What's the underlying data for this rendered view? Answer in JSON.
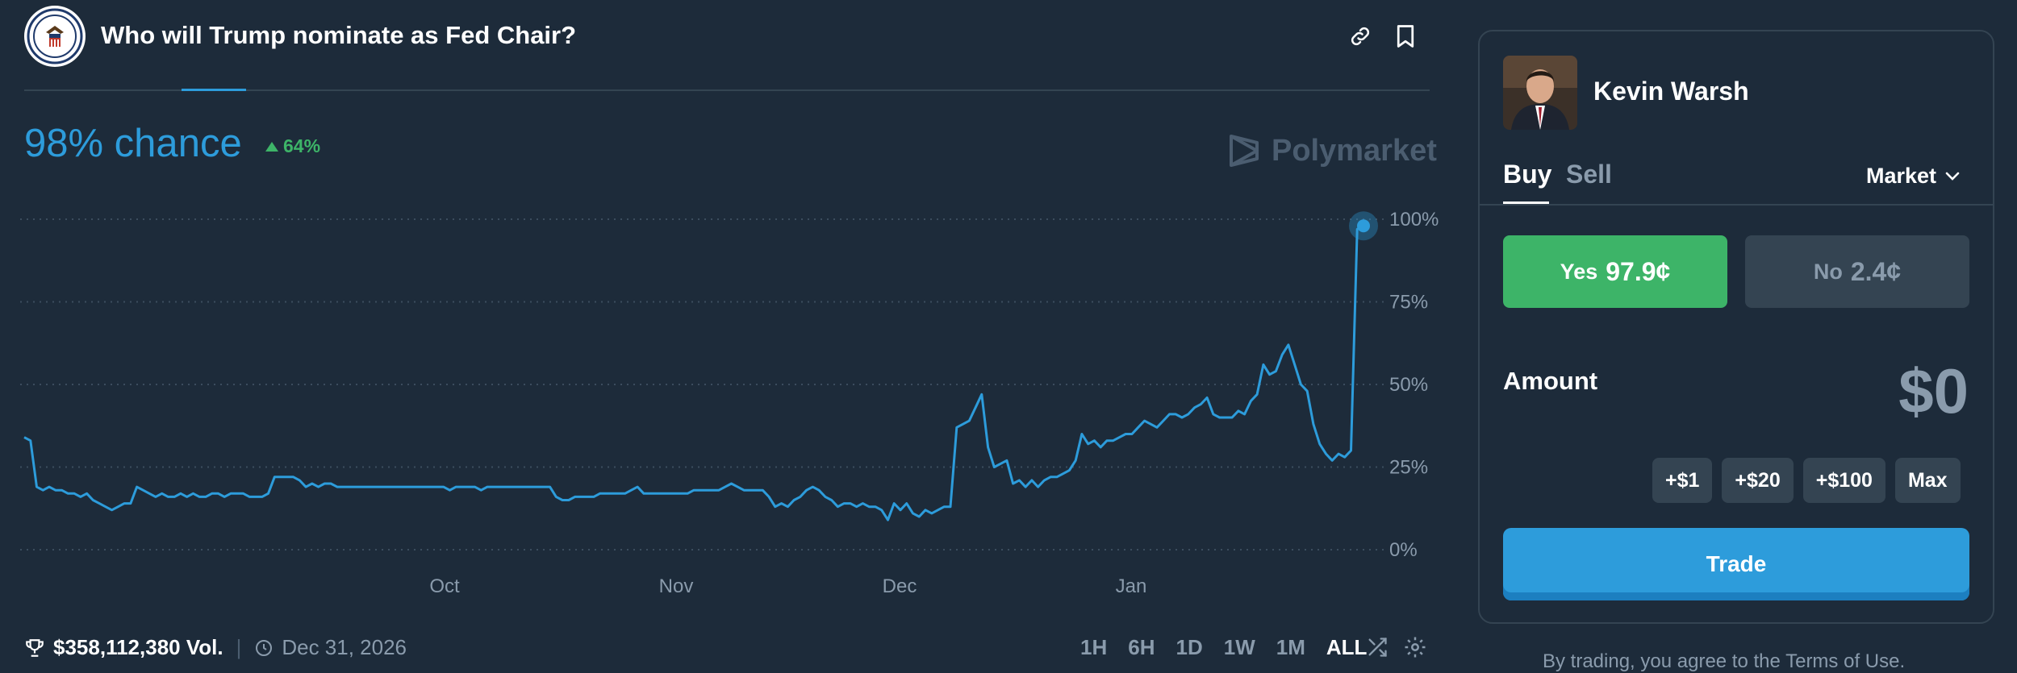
{
  "header": {
    "title": "Who will Trump nominate as Fed Chair?",
    "icons": [
      "link-icon",
      "bookmark-icon"
    ]
  },
  "summary": {
    "chance": "98% chance",
    "delta": "64%"
  },
  "watermark": "Polymarket",
  "chart_data": {
    "type": "line",
    "y_ticks": [
      "100%",
      "75%",
      "50%",
      "25%",
      "0%"
    ],
    "x_ticks": [
      "Oct",
      "Nov",
      "Dec",
      "Jan"
    ],
    "ylim": [
      0,
      100
    ],
    "grid": true,
    "color": "#2d9cdb",
    "series": [
      {
        "values": [
          34,
          33,
          19,
          18,
          19,
          18,
          18,
          17,
          17,
          16,
          17,
          15,
          14,
          13,
          12,
          13,
          14,
          14,
          19,
          18,
          17,
          16,
          17,
          16,
          16,
          17,
          16,
          17,
          16,
          16,
          17,
          17,
          16,
          17,
          17,
          17,
          16,
          16,
          16,
          17,
          22,
          22,
          22,
          22,
          21,
          19,
          20,
          19,
          20,
          20,
          19,
          19,
          19,
          19,
          19,
          19,
          19,
          19,
          19,
          19,
          19,
          19,
          19,
          19,
          19,
          19,
          19,
          19,
          18,
          19,
          19,
          19,
          19,
          18,
          19,
          19,
          19,
          19,
          19,
          19,
          19,
          19,
          19,
          19,
          19,
          16,
          15,
          15,
          16,
          16,
          16,
          16,
          17,
          17,
          17,
          17,
          17,
          18,
          19,
          17,
          17,
          17,
          17,
          17,
          17,
          17,
          17,
          18,
          18,
          18,
          18,
          18,
          19,
          20,
          19,
          18,
          18,
          18,
          18,
          16,
          13,
          14,
          13,
          15,
          16,
          18,
          19,
          18,
          16,
          15,
          13,
          14,
          14,
          13,
          14,
          13,
          13,
          12,
          9,
          14,
          12,
          14,
          11,
          10,
          12,
          11,
          12,
          13,
          13,
          37,
          38,
          39,
          43,
          47,
          31,
          25,
          26,
          27,
          20,
          21,
          19,
          21,
          19,
          21,
          22,
          22,
          23,
          24,
          27,
          35,
          32,
          33,
          31,
          33,
          33,
          34,
          35,
          35,
          37,
          39,
          38,
          37,
          39,
          41,
          41,
          40,
          41,
          43,
          44,
          46,
          41,
          40,
          40,
          40,
          42,
          41,
          45,
          47,
          56,
          53,
          54,
          59,
          62,
          56,
          50,
          48,
          38,
          32,
          29,
          27,
          29,
          28,
          30,
          97,
          98
        ]
      }
    ]
  },
  "footer": {
    "volume": "$358,112,380 Vol.",
    "separator": "|",
    "end_date": "Dec 31, 2026",
    "ranges": [
      "1H",
      "6H",
      "1D",
      "1W",
      "1M",
      "ALL"
    ],
    "active_range": "ALL"
  },
  "panel": {
    "candidate": "Kevin Warsh",
    "tabs": {
      "buy": "Buy",
      "sell": "Sell"
    },
    "order_type": "Market",
    "yes": {
      "label": "Yes",
      "price": "97.9¢"
    },
    "no": {
      "label": "No",
      "price": "2.4¢"
    },
    "amount_label": "Amount",
    "amount_value": "$0",
    "chips": [
      "+$1",
      "+$20",
      "+$100",
      "Max"
    ],
    "trade_label": "Trade",
    "terms": "By trading, you agree to the Terms of Use."
  },
  "colors": {
    "background": "#1d2b3a",
    "accent": "#2d9cdb",
    "yes": "#3db468",
    "no": "#344452",
    "muted": "#8a9bac"
  }
}
